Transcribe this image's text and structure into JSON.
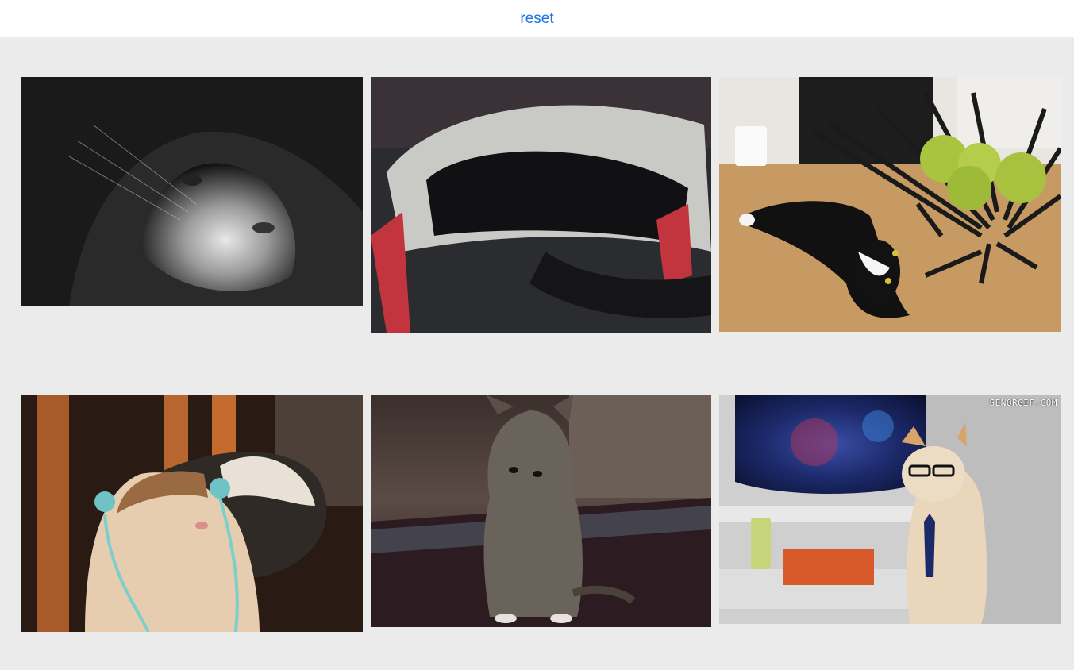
{
  "toolbar": {
    "reset_label": "reset"
  },
  "gallery": {
    "items": [
      {
        "subject": "black-and-white cat close-up"
      },
      {
        "subject": "black cat inside plastic bag"
      },
      {
        "subject": "black cat under fruit bowl with green apples"
      },
      {
        "subject": "smiling cat with toy on head"
      },
      {
        "subject": "tabby kitten on table"
      },
      {
        "subject": "cat wearing glasses and tie in spaceship",
        "overlay_text": "SENORGIF.COM"
      }
    ]
  },
  "colors": {
    "accent": "#1a73e8",
    "background": "#ebebeb"
  }
}
